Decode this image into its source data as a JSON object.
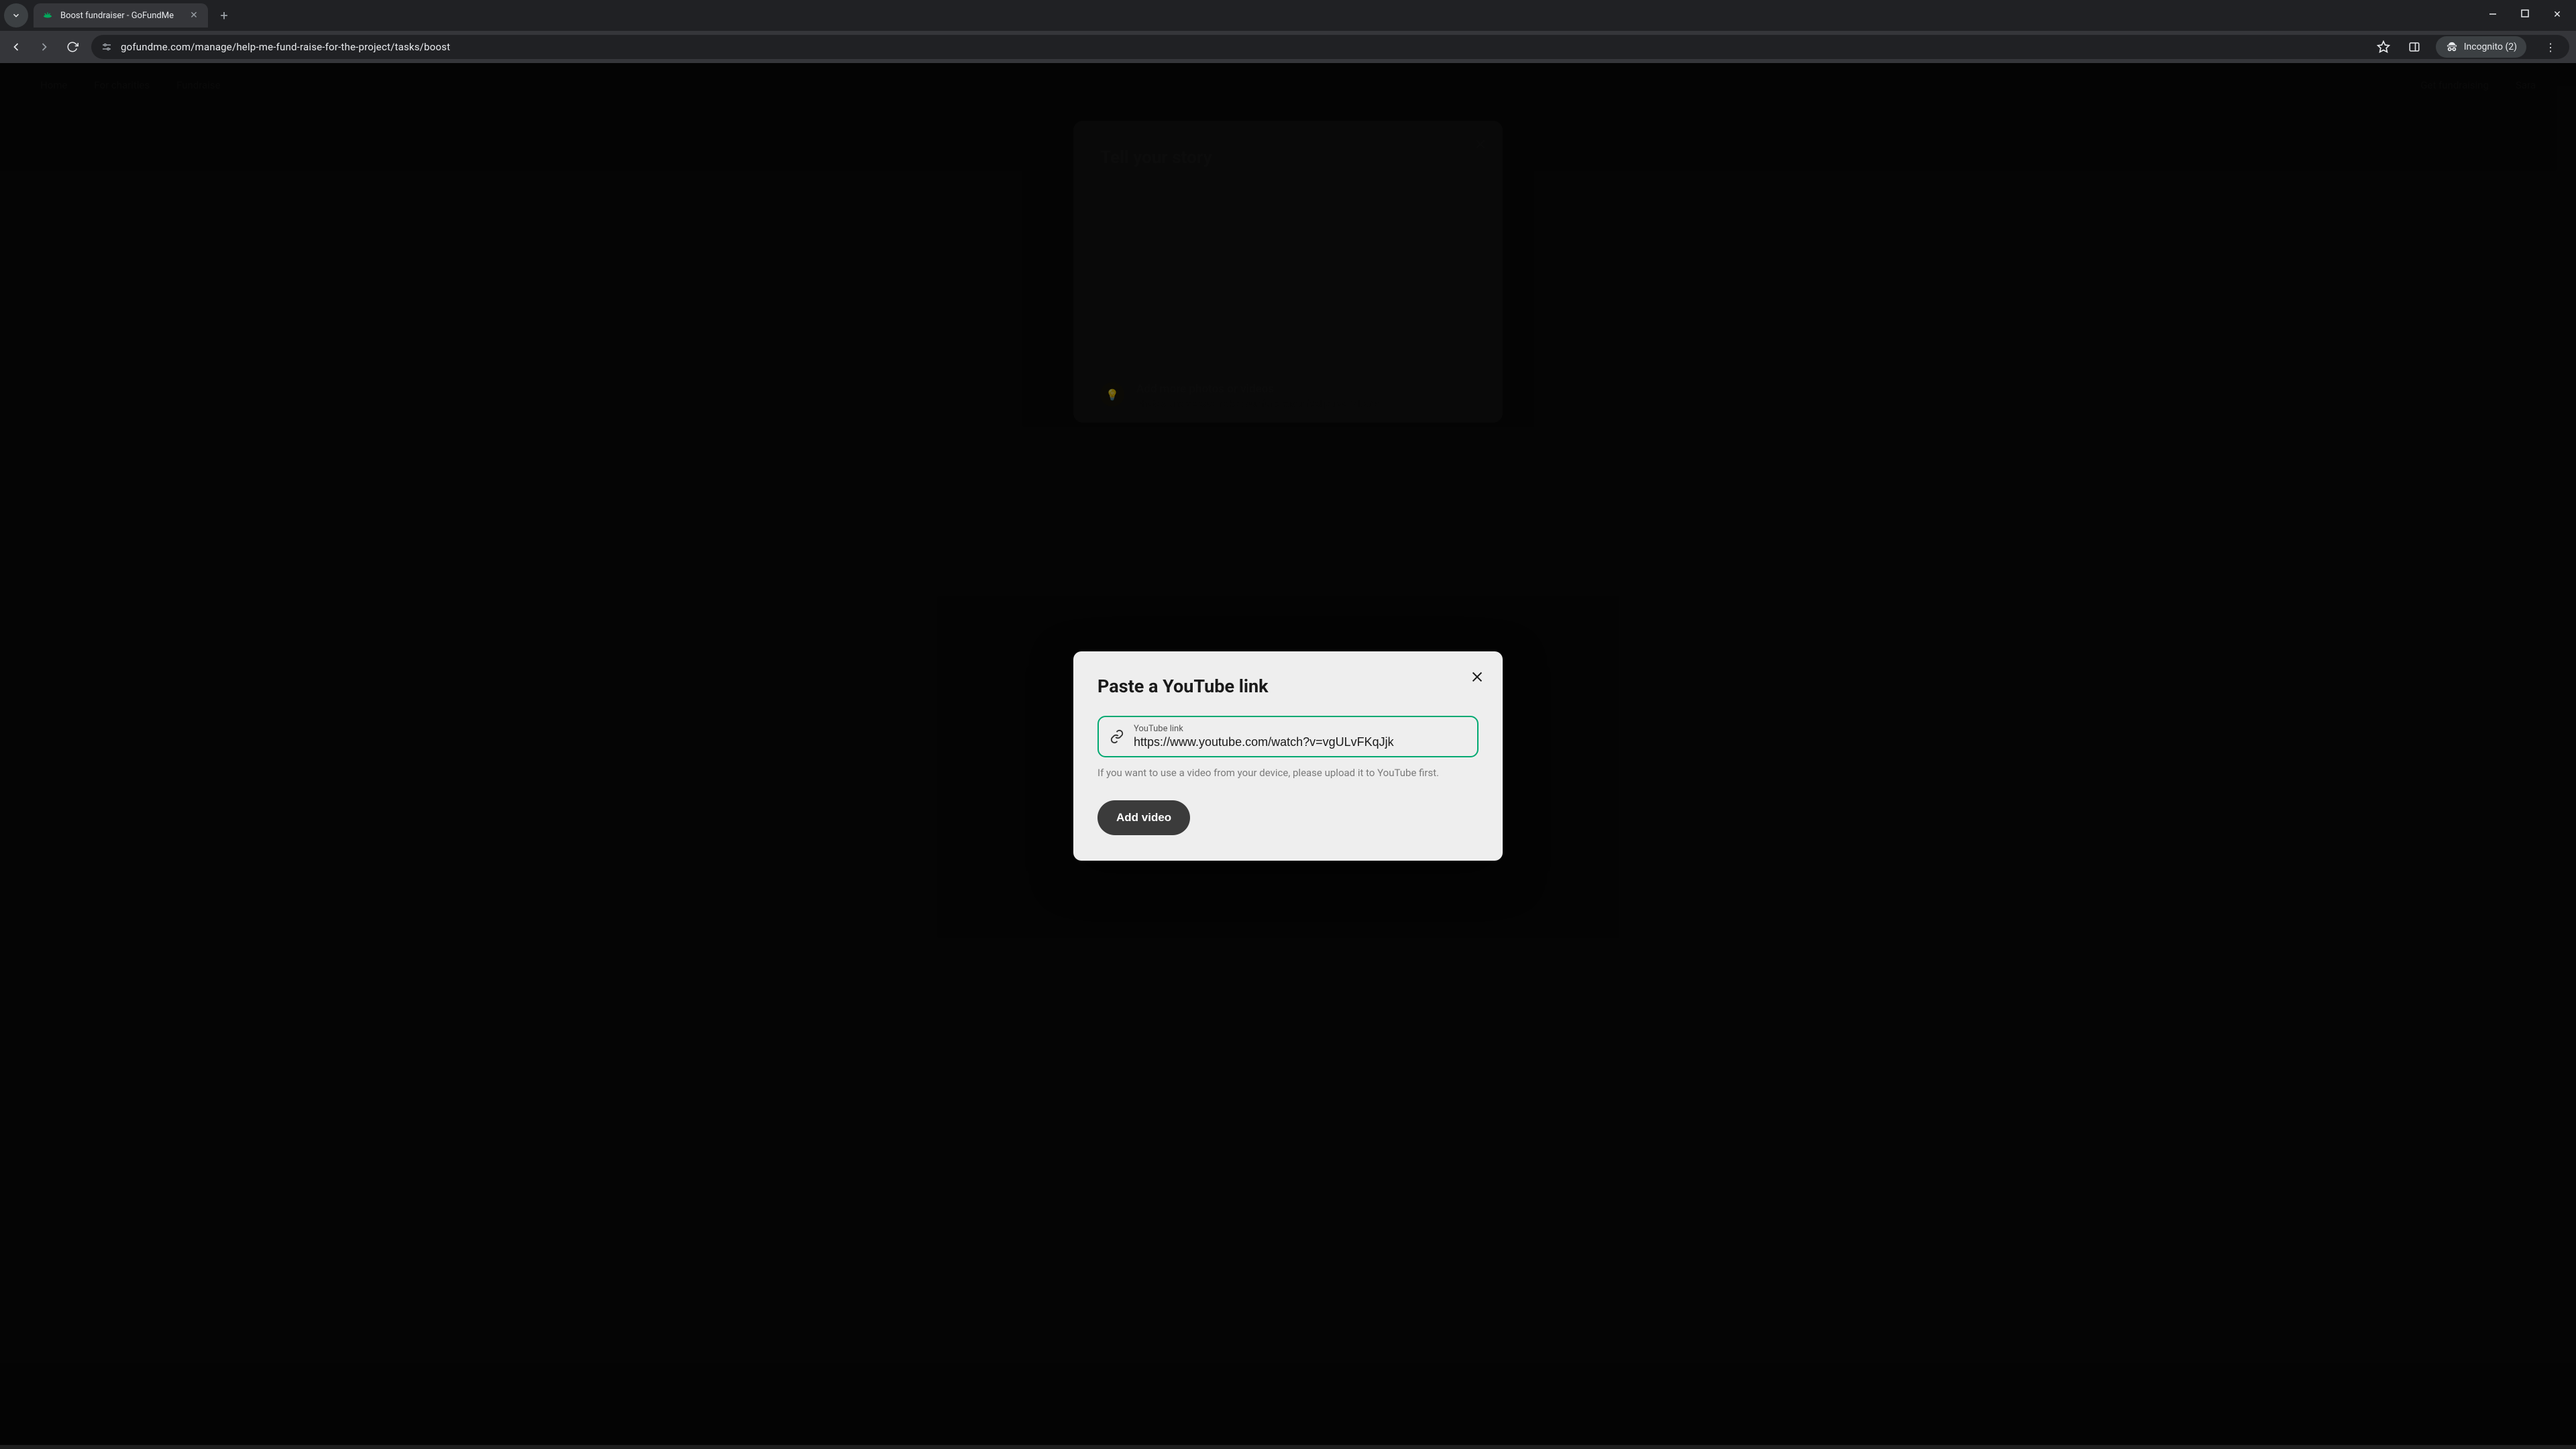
{
  "browser": {
    "tab_title": "Boost fundraiser - GoFundMe",
    "url": "gofundme.com/manage/help-me-fund-raise-for-the-project/tasks/boost",
    "incognito_label": "Incognito (2)"
  },
  "background_page": {
    "nav_left_1": "Home",
    "nav_left_2": "For charities",
    "nav_left_3": "Fundraise",
    "nav_right_1": "Get fundraising",
    "nav_right_2": "Sara",
    "card_title": "Tell your story",
    "tip_title": "Add more photos or videos",
    "tip_sub": "Photos and videos make your fundraiser feel personal, and"
  },
  "modal": {
    "title": "Paste a YouTube link",
    "field_label": "YouTube link",
    "field_value": "https://www.youtube.com/watch?v=vgULvFKqJjk",
    "helper": "If you want to use a video from your device, please upload it to YouTube first.",
    "button": "Add video"
  }
}
